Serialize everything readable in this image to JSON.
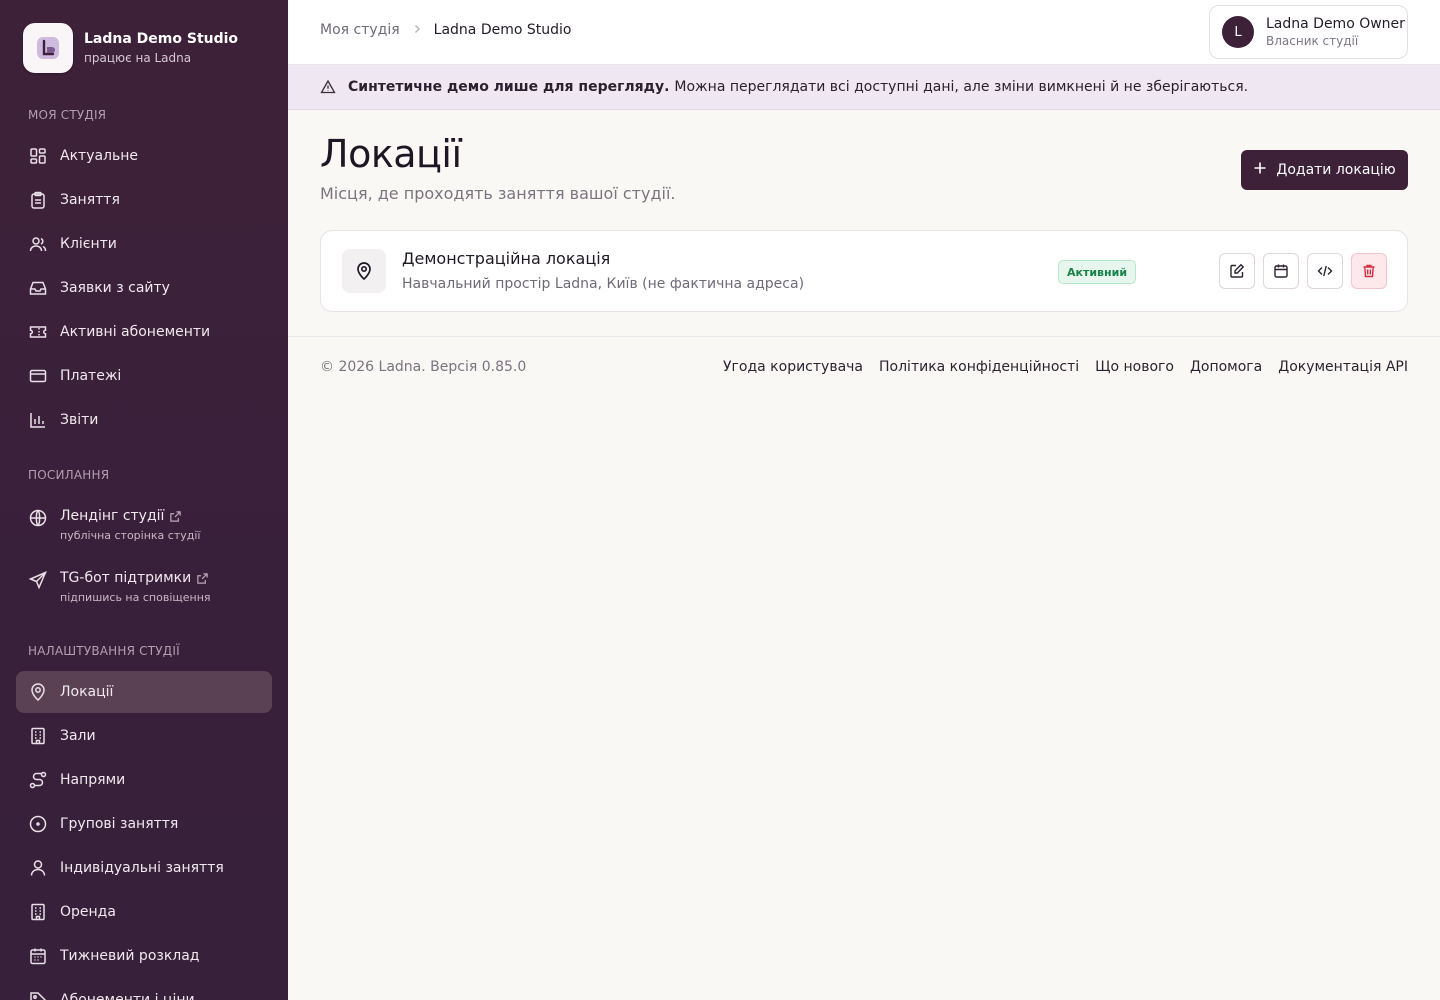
{
  "brand": {
    "name": "Ladna Demo Studio",
    "subtitle": "працює на Ladna"
  },
  "sidebar": {
    "sections": {
      "my_studio": "МОЯ СТУДІЯ",
      "links": "ПОСИЛАННЯ",
      "settings": "НАЛАШТУВАННЯ СТУДІЇ"
    },
    "main_items": [
      {
        "label": "Актуальне",
        "icon": "dashboard-icon"
      },
      {
        "label": "Заняття",
        "icon": "clipboard-icon"
      },
      {
        "label": "Клієнти",
        "icon": "users-icon"
      },
      {
        "label": "Заявки з сайту",
        "icon": "inbox-icon"
      },
      {
        "label": "Активні абонементи",
        "icon": "ticket-icon"
      },
      {
        "label": "Платежі",
        "icon": "credit-card-icon"
      },
      {
        "label": "Звіти",
        "icon": "bar-chart-icon"
      }
    ],
    "link_items": [
      {
        "label": "Лендінг студії",
        "sub": "публічна сторінка студії",
        "icon": "globe-icon"
      },
      {
        "label": "TG-бот підтримки",
        "sub": "підпишись на сповіщення",
        "icon": "send-icon"
      }
    ],
    "settings_items": [
      {
        "label": "Локації",
        "icon": "map-pin-icon",
        "active": true
      },
      {
        "label": "Зали",
        "icon": "building-icon"
      },
      {
        "label": "Напрями",
        "icon": "route-icon"
      },
      {
        "label": "Групові заняття",
        "icon": "circle-dot-icon"
      },
      {
        "label": "Індивідуальні заняття",
        "icon": "user-icon"
      },
      {
        "label": "Оренда",
        "icon": "building-icon"
      },
      {
        "label": "Тижневий розклад",
        "icon": "calendar-icon"
      },
      {
        "label": "Абонементи і ціни",
        "icon": "tag-icon"
      }
    ]
  },
  "topbar": {
    "breadcrumb": [
      "Моя студія",
      "Ladna Demo Studio"
    ],
    "user": {
      "initial": "L",
      "name": "Ladna Demo Owner",
      "role": "Власник студії"
    }
  },
  "banner": {
    "bold": "Синтетичне демо лише для перегляду.",
    "text": "Можна переглядати всі доступні дані, але зміни вимкнені й не зберігаються."
  },
  "page": {
    "title": "Локації",
    "subtitle": "Місця, де проходять заняття вашої студії.",
    "add_button": "Додати локацію"
  },
  "locations": [
    {
      "name": "Демонстраційна локація",
      "address": "Навчальний простір Ladna, Київ (не фактична адреса)",
      "status": "Активний"
    }
  ],
  "footer": {
    "copyright": "© 2026 Ladna. Версія 0.85.0",
    "links": [
      "Угода користувача",
      "Політика конфіденційності",
      "Що нового",
      "Допомога",
      "Документація API"
    ]
  },
  "colors": {
    "sidebar": "#3d2139",
    "accent": "#3d2139",
    "active_badge": "#17834a",
    "danger": "#d92d3f"
  }
}
